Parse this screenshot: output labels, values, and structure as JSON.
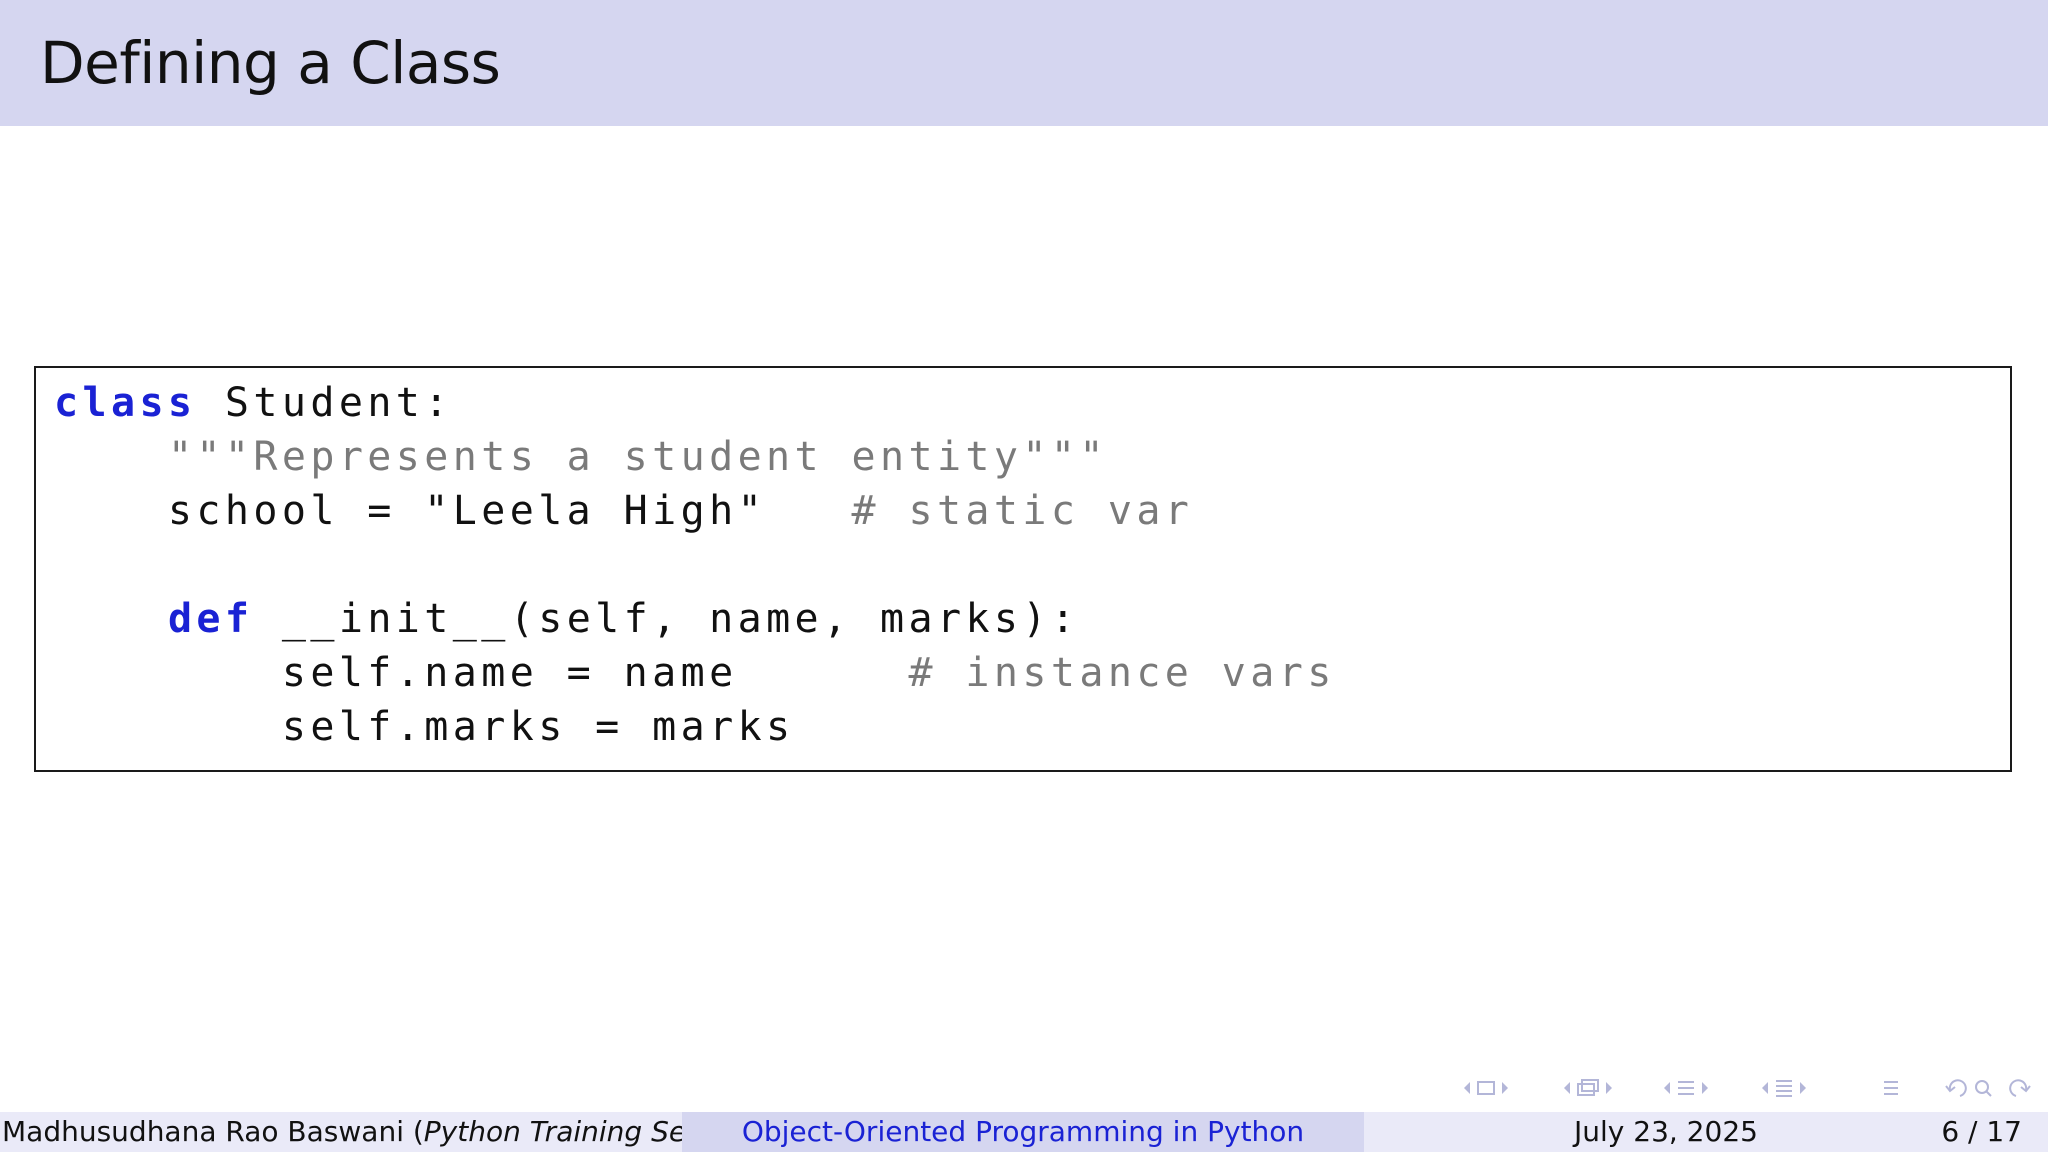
{
  "slide": {
    "title": "Defining a Class"
  },
  "code": {
    "line1_kw": "class",
    "line1_rest": " Student:",
    "line2_indent": "    ",
    "line2_str": "\"\"\"Represents a student entity\"\"\"",
    "line3_code": "    school = \"Leela High\"   ",
    "line3_cmt": "# static var",
    "line5_indent": "    ",
    "line5_kw": "def",
    "line5_rest": " __init__(self, name, marks):",
    "line6_code": "        self.name = name      ",
    "line6_cmt": "# instance vars",
    "line7_code": "        self.marks = marks"
  },
  "footer": {
    "author": "Madhusudhana Rao Baswani (",
    "author_italic": "Python Training Seri",
    "course": "Object-Oriented Programming in Python",
    "date": "July 23, 2025",
    "page": "6 / 17"
  },
  "navigation": {
    "icons": [
      "frame-prev-icon",
      "frame-icon",
      "frame-next-icon",
      "subsection-prev-icon",
      "subsection-icon",
      "subsection-next-icon",
      "section-prev-icon",
      "section-icon",
      "section-next-icon",
      "presentation-prev-icon",
      "presentation-icon",
      "presentation-next-icon",
      "align-icon",
      "back-icon",
      "search-icon",
      "forward-icon"
    ]
  }
}
